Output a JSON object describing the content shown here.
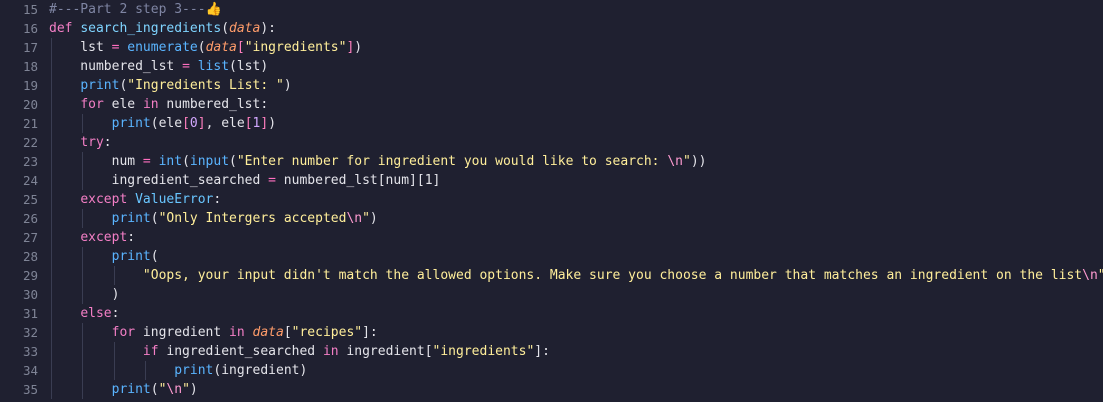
{
  "editor": {
    "lines": [
      {
        "num": "15",
        "segments": [
          [
            "cm",
            "#---Part 2 step 3---"
          ],
          [
            "thumb",
            "👍"
          ]
        ]
      },
      {
        "num": "16",
        "segments": [
          [
            "kw",
            "def "
          ],
          [
            "fn",
            "search_ingredients"
          ],
          [
            "",
            "("
          ],
          [
            "pa",
            "data"
          ],
          [
            "",
            "):"
          ]
        ]
      },
      {
        "num": "17",
        "segments": [
          [
            "",
            "    lst "
          ],
          [
            "op",
            "="
          ],
          [
            "",
            " "
          ],
          [
            "bi",
            "enumerate"
          ],
          [
            "",
            "("
          ],
          [
            "pa",
            "data"
          ],
          [
            "br",
            "["
          ],
          [
            "st",
            "\"ingredients\""
          ],
          [
            "br",
            "]"
          ],
          [
            "",
            ")"
          ]
        ]
      },
      {
        "num": "18",
        "segments": [
          [
            "",
            "    numbered_lst "
          ],
          [
            "op",
            "="
          ],
          [
            "",
            " "
          ],
          [
            "bi",
            "list"
          ],
          [
            "",
            "(lst)"
          ]
        ]
      },
      {
        "num": "19",
        "segments": [
          [
            "",
            "    "
          ],
          [
            "bi",
            "print"
          ],
          [
            "",
            "("
          ],
          [
            "st",
            "\"Ingredients List: \""
          ],
          [
            "",
            ")"
          ]
        ]
      },
      {
        "num": "20",
        "segments": [
          [
            "",
            "    "
          ],
          [
            "kw",
            "for"
          ],
          [
            "",
            " ele "
          ],
          [
            "kw",
            "in"
          ],
          [
            "",
            " numbered_lst:"
          ]
        ]
      },
      {
        "num": "21",
        "segments": [
          [
            "",
            "        "
          ],
          [
            "bi",
            "print"
          ],
          [
            "",
            "(ele"
          ],
          [
            "br",
            "["
          ],
          [
            "nm",
            "0"
          ],
          [
            "br",
            "]"
          ],
          [
            "",
            ", ele"
          ],
          [
            "br",
            "["
          ],
          [
            "nm",
            "1"
          ],
          [
            "br",
            "]"
          ],
          [
            "",
            ")"
          ]
        ]
      },
      {
        "num": "22",
        "segments": [
          [
            "",
            "    "
          ],
          [
            "kw",
            "try"
          ],
          [
            "",
            ":"
          ]
        ]
      },
      {
        "num": "23",
        "segments": [
          [
            "",
            "        num "
          ],
          [
            "op",
            "="
          ],
          [
            "",
            " "
          ],
          [
            "bi",
            "int"
          ],
          [
            "",
            "("
          ],
          [
            "bi",
            "input"
          ],
          [
            "",
            "("
          ],
          [
            "st",
            "\"Enter number for ingredient you would like to search: "
          ],
          [
            "esc",
            "\\n"
          ],
          [
            "st",
            "\""
          ],
          [
            "",
            "))"
          ]
        ]
      },
      {
        "num": "24",
        "segments": [
          [
            "",
            "        ingredient_searched "
          ],
          [
            "op",
            "="
          ],
          [
            "",
            " numbered_lst[num][1]"
          ]
        ]
      },
      {
        "num": "25",
        "segments": [
          [
            "",
            "    "
          ],
          [
            "kw",
            "except"
          ],
          [
            "",
            " "
          ],
          [
            "cls",
            "ValueError"
          ],
          [
            "",
            ":"
          ]
        ]
      },
      {
        "num": "26",
        "segments": [
          [
            "",
            "        "
          ],
          [
            "bi",
            "print"
          ],
          [
            "",
            "("
          ],
          [
            "st",
            "\"Only Intergers accepted"
          ],
          [
            "esc",
            "\\n"
          ],
          [
            "st",
            "\""
          ],
          [
            "",
            ")"
          ]
        ]
      },
      {
        "num": "27",
        "segments": [
          [
            "",
            "    "
          ],
          [
            "kw",
            "except"
          ],
          [
            "",
            ":"
          ]
        ]
      },
      {
        "num": "28",
        "segments": [
          [
            "",
            "        "
          ],
          [
            "bi",
            "print"
          ],
          [
            "",
            "("
          ]
        ]
      },
      {
        "num": "29",
        "segments": [
          [
            "",
            "            "
          ],
          [
            "st",
            "\"Oops, your input didn't match the allowed options. Make sure you choose a number that matches an ingredient on the list"
          ],
          [
            "esc",
            "\\n"
          ],
          [
            "st",
            "\""
          ]
        ]
      },
      {
        "num": "30",
        "segments": [
          [
            "",
            "        )"
          ]
        ]
      },
      {
        "num": "31",
        "segments": [
          [
            "",
            "    "
          ],
          [
            "kw",
            "else"
          ],
          [
            "",
            ":"
          ]
        ]
      },
      {
        "num": "32",
        "segments": [
          [
            "",
            "        "
          ],
          [
            "kw",
            "for"
          ],
          [
            "",
            " ingredient "
          ],
          [
            "kw",
            "in"
          ],
          [
            "",
            " "
          ],
          [
            "pa",
            "data"
          ],
          [
            "",
            "["
          ],
          [
            "st",
            "\"recipes\""
          ],
          [
            "",
            "]:"
          ]
        ]
      },
      {
        "num": "33",
        "segments": [
          [
            "",
            "            "
          ],
          [
            "kw",
            "if"
          ],
          [
            "",
            " ingredient_searched "
          ],
          [
            "kw",
            "in"
          ],
          [
            "",
            " ingredient["
          ],
          [
            "st",
            "\"ingredients\""
          ],
          [
            "",
            "]:"
          ]
        ]
      },
      {
        "num": "34",
        "segments": [
          [
            "",
            "                "
          ],
          [
            "bi",
            "print"
          ],
          [
            "",
            "(ingredient)"
          ]
        ]
      },
      {
        "num": "35",
        "segments": [
          [
            "",
            "        "
          ],
          [
            "bi",
            "print"
          ],
          [
            "",
            "("
          ],
          [
            "st",
            "\""
          ],
          [
            "esc",
            "\\n"
          ],
          [
            "st",
            "\""
          ],
          [
            "",
            ")"
          ]
        ]
      }
    ]
  }
}
